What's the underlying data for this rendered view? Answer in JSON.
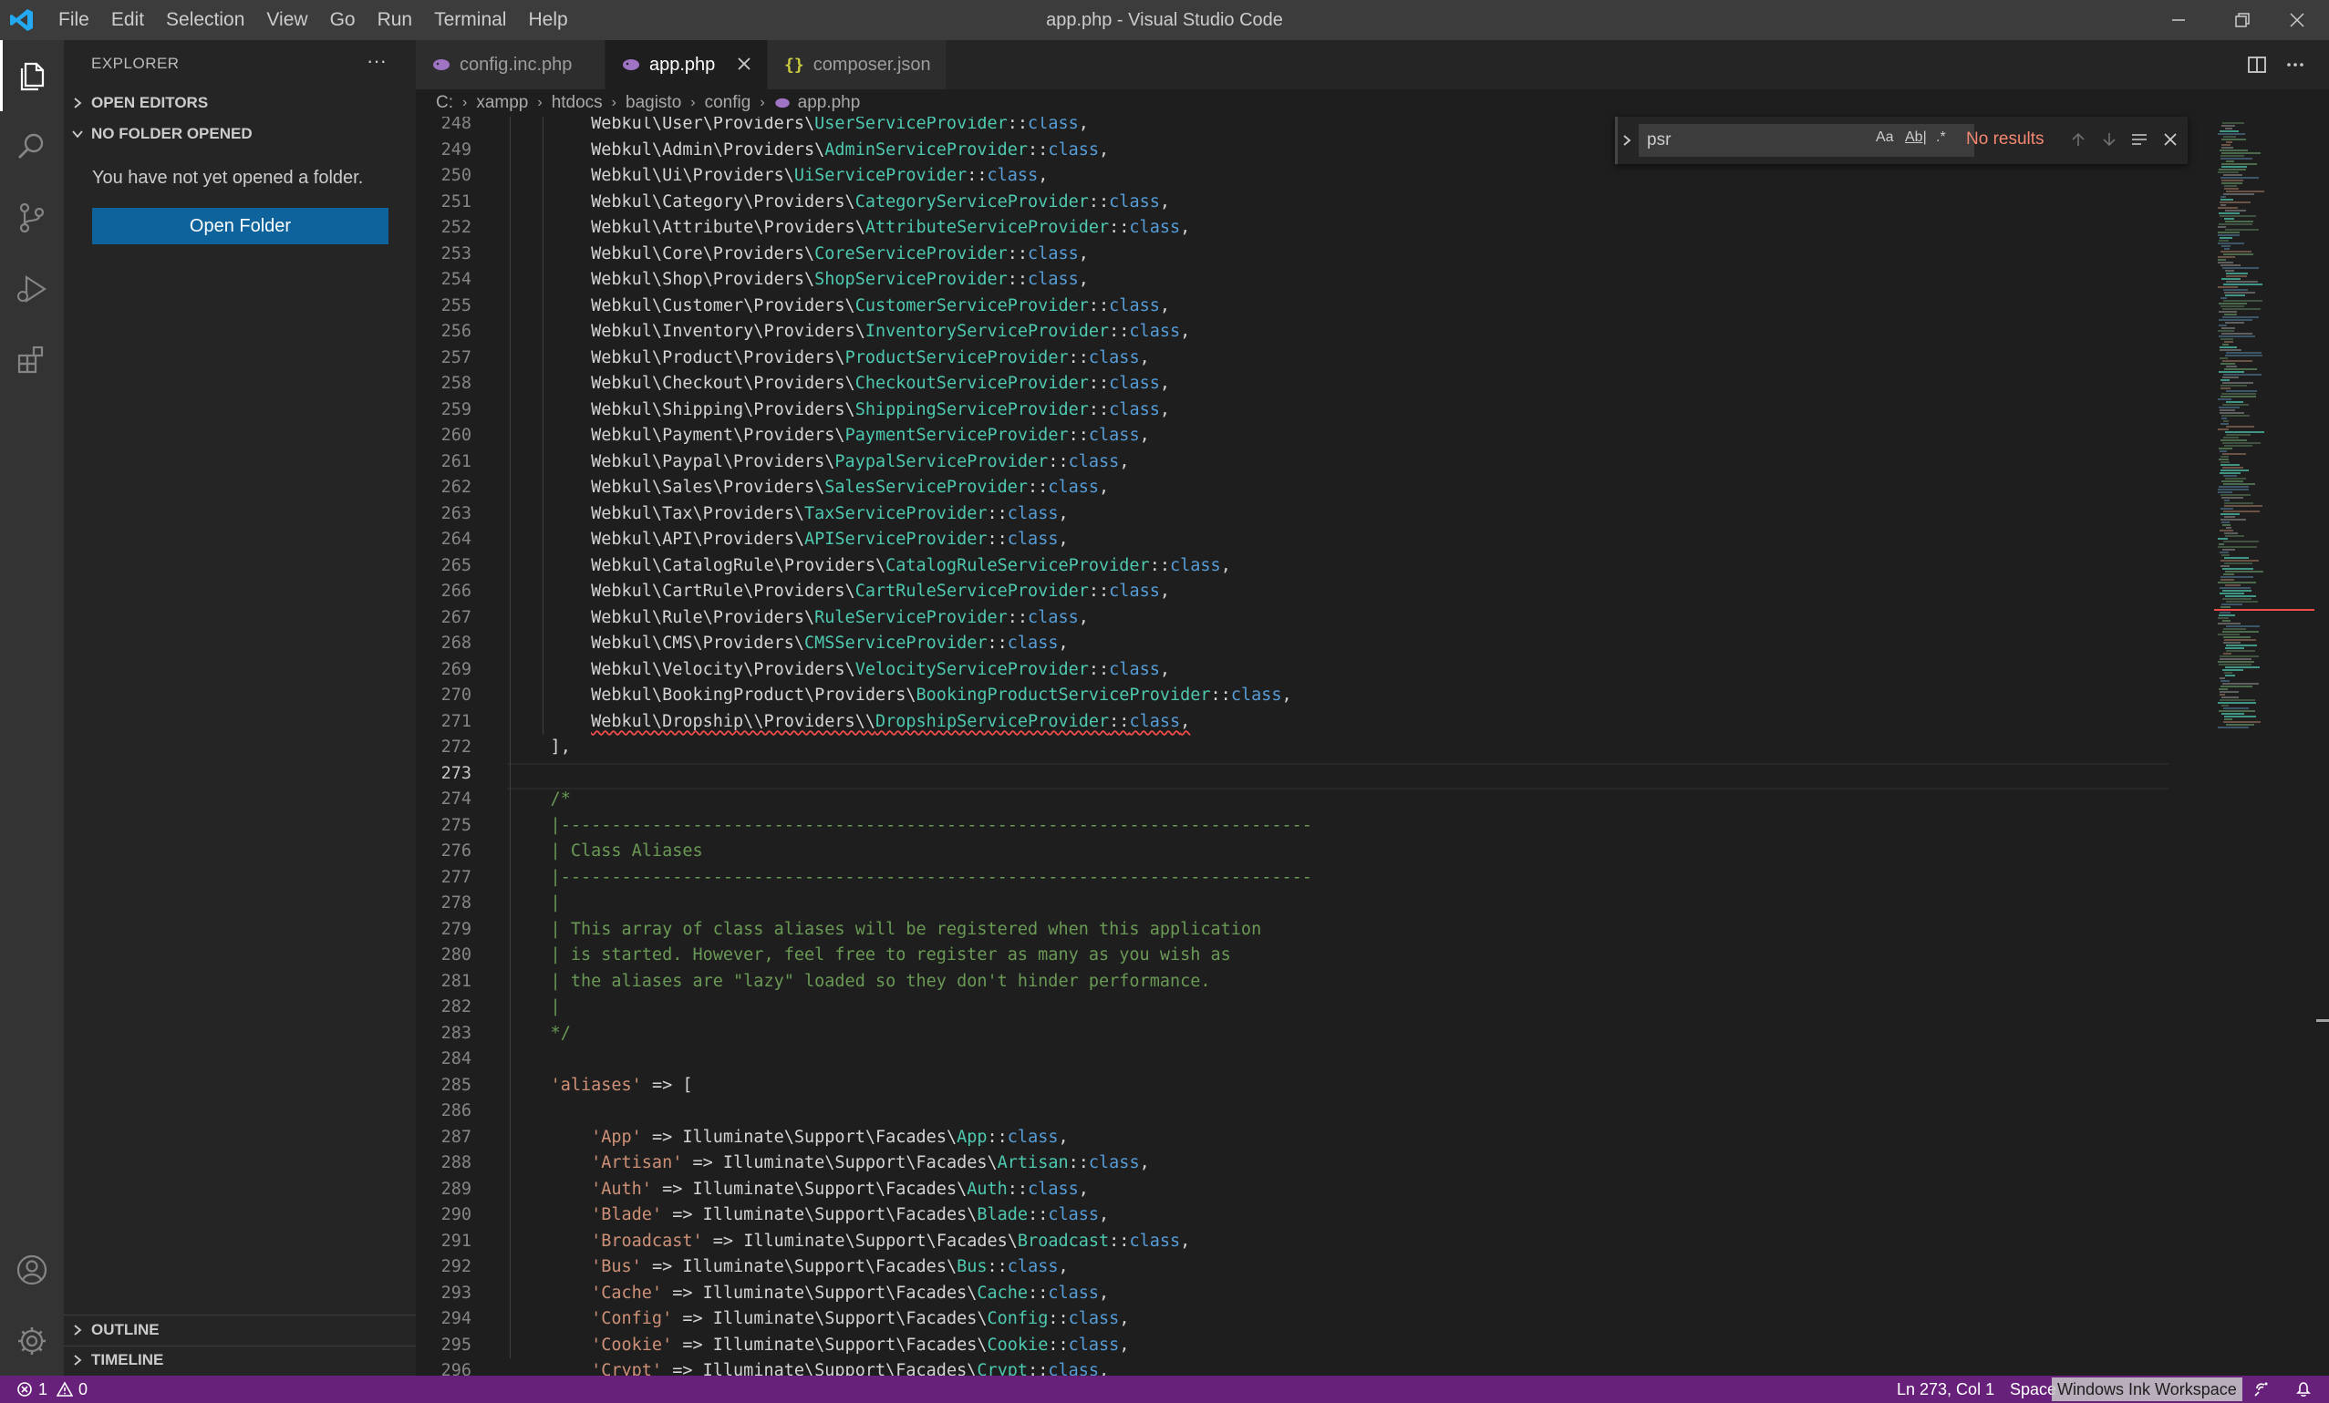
{
  "window": {
    "title": "app.php - Visual Studio Code",
    "menu": [
      "File",
      "Edit",
      "Selection",
      "View",
      "Go",
      "Run",
      "Terminal",
      "Help"
    ]
  },
  "activity_bar": {
    "items": [
      "explorer-icon",
      "search-icon",
      "source-control-icon",
      "run-debug-icon",
      "extensions-icon"
    ],
    "bottom": [
      "account-icon",
      "manage-gear-icon"
    ]
  },
  "sidebar": {
    "title": "EXPLORER",
    "more": "···",
    "open_editors": "OPEN EDITORS",
    "no_folder": "NO FOLDER OPENED",
    "message": "You have not yet opened a folder.",
    "open_folder_button": "Open Folder",
    "outline": "OUTLINE",
    "timeline": "TIMELINE"
  },
  "tabs": [
    {
      "label": "config.inc.php",
      "icon": "php-elephant-icon",
      "active": false
    },
    {
      "label": "app.php",
      "icon": "php-elephant-icon",
      "active": true
    },
    {
      "label": "composer.json",
      "icon": "json-braces-icon",
      "active": false
    }
  ],
  "breadcrumb": [
    "C:",
    "xampp",
    "htdocs",
    "bagisto",
    "config",
    "app.php"
  ],
  "find_widget": {
    "query": "psr",
    "options": [
      "Aa",
      "Ab|",
      ".*"
    ],
    "status": "No results"
  },
  "editor": {
    "lines": [
      {
        "n": "248",
        "t": "        Webkul\\User\\Providers\\UserServiceProvider::class,"
      },
      {
        "n": "249",
        "t": "        Webkul\\Admin\\Providers\\AdminServiceProvider::class,"
      },
      {
        "n": "250",
        "t": "        Webkul\\Ui\\Providers\\UiServiceProvider::class,"
      },
      {
        "n": "251",
        "t": "        Webkul\\Category\\Providers\\CategoryServiceProvider::class,"
      },
      {
        "n": "252",
        "t": "        Webkul\\Attribute\\Providers\\AttributeServiceProvider::class,"
      },
      {
        "n": "253",
        "t": "        Webkul\\Core\\Providers\\CoreServiceProvider::class,"
      },
      {
        "n": "254",
        "t": "        Webkul\\Shop\\Providers\\ShopServiceProvider::class,"
      },
      {
        "n": "255",
        "t": "        Webkul\\Customer\\Providers\\CustomerServiceProvider::class,"
      },
      {
        "n": "256",
        "t": "        Webkul\\Inventory\\Providers\\InventoryServiceProvider::class,"
      },
      {
        "n": "257",
        "t": "        Webkul\\Product\\Providers\\ProductServiceProvider::class,"
      },
      {
        "n": "258",
        "t": "        Webkul\\Checkout\\Providers\\CheckoutServiceProvider::class,"
      },
      {
        "n": "259",
        "t": "        Webkul\\Shipping\\Providers\\ShippingServiceProvider::class,"
      },
      {
        "n": "260",
        "t": "        Webkul\\Payment\\Providers\\PaymentServiceProvider::class,"
      },
      {
        "n": "261",
        "t": "        Webkul\\Paypal\\Providers\\PaypalServiceProvider::class,"
      },
      {
        "n": "262",
        "t": "        Webkul\\Sales\\Providers\\SalesServiceProvider::class,"
      },
      {
        "n": "263",
        "t": "        Webkul\\Tax\\Providers\\TaxServiceProvider::class,"
      },
      {
        "n": "264",
        "t": "        Webkul\\API\\Providers\\APIServiceProvider::class,"
      },
      {
        "n": "265",
        "t": "        Webkul\\CatalogRule\\Providers\\CatalogRuleServiceProvider::class,"
      },
      {
        "n": "266",
        "t": "        Webkul\\CartRule\\Providers\\CartRuleServiceProvider::class,"
      },
      {
        "n": "267",
        "t": "        Webkul\\Rule\\Providers\\RuleServiceProvider::class,"
      },
      {
        "n": "268",
        "t": "        Webkul\\CMS\\Providers\\CMSServiceProvider::class,"
      },
      {
        "n": "269",
        "t": "        Webkul\\Velocity\\Providers\\VelocityServiceProvider::class,"
      },
      {
        "n": "270",
        "t": "        Webkul\\BookingProduct\\Providers\\BookingProductServiceProvider::class,"
      },
      {
        "n": "271",
        "t": "        Webkul\\Dropship\\\\Providers\\\\DropshipServiceProvider::class,"
      },
      {
        "n": "272",
        "t": "    ],"
      },
      {
        "n": "273",
        "t": ""
      },
      {
        "n": "274",
        "t": "    /*"
      },
      {
        "n": "275",
        "t": "    |--------------------------------------------------------------------------"
      },
      {
        "n": "276",
        "t": "    | Class Aliases"
      },
      {
        "n": "277",
        "t": "    |--------------------------------------------------------------------------"
      },
      {
        "n": "278",
        "t": "    |"
      },
      {
        "n": "279",
        "t": "    | This array of class aliases will be registered when this application"
      },
      {
        "n": "280",
        "t": "    | is started. However, feel free to register as many as you wish as"
      },
      {
        "n": "281",
        "t": "    | the aliases are \"lazy\" loaded so they don't hinder performance."
      },
      {
        "n": "282",
        "t": "    |"
      },
      {
        "n": "283",
        "t": "    */"
      },
      {
        "n": "284",
        "t": ""
      },
      {
        "n": "285",
        "t": "    'aliases' => ["
      },
      {
        "n": "286",
        "t": ""
      },
      {
        "n": "287",
        "t": "        'App' => Illuminate\\Support\\Facades\\App::class,"
      },
      {
        "n": "288",
        "t": "        'Artisan' => Illuminate\\Support\\Facades\\Artisan::class,"
      },
      {
        "n": "289",
        "t": "        'Auth' => Illuminate\\Support\\Facades\\Auth::class,"
      },
      {
        "n": "290",
        "t": "        'Blade' => Illuminate\\Support\\Facades\\Blade::class,"
      },
      {
        "n": "291",
        "t": "        'Broadcast' => Illuminate\\Support\\Facades\\Broadcast::class,"
      },
      {
        "n": "292",
        "t": "        'Bus' => Illuminate\\Support\\Facades\\Bus::class,"
      },
      {
        "n": "293",
        "t": "        'Cache' => Illuminate\\Support\\Facades\\Cache::class,"
      },
      {
        "n": "294",
        "t": "        'Config' => Illuminate\\Support\\Facades\\Config::class,"
      },
      {
        "n": "295",
        "t": "        'Cookie' => Illuminate\\Support\\Facades\\Cookie::class,"
      },
      {
        "n": "296",
        "t": "        'Crypt' => Illuminate\\Support\\Facades\\Crypt::class,"
      }
    ]
  },
  "status_bar": {
    "errors": "1",
    "warnings": "0",
    "cursor": "Ln 273, Col 1",
    "spaces": "Space",
    "overlay": "Windows Ink Workspace"
  },
  "colors": {
    "status_bar": "#68217a",
    "accent_button": "#0e639c",
    "class_name": "#4ec9b0",
    "keyword": "#569cd6",
    "string": "#ce9178",
    "comment": "#6a9955",
    "find_no_results": "#f48771"
  }
}
